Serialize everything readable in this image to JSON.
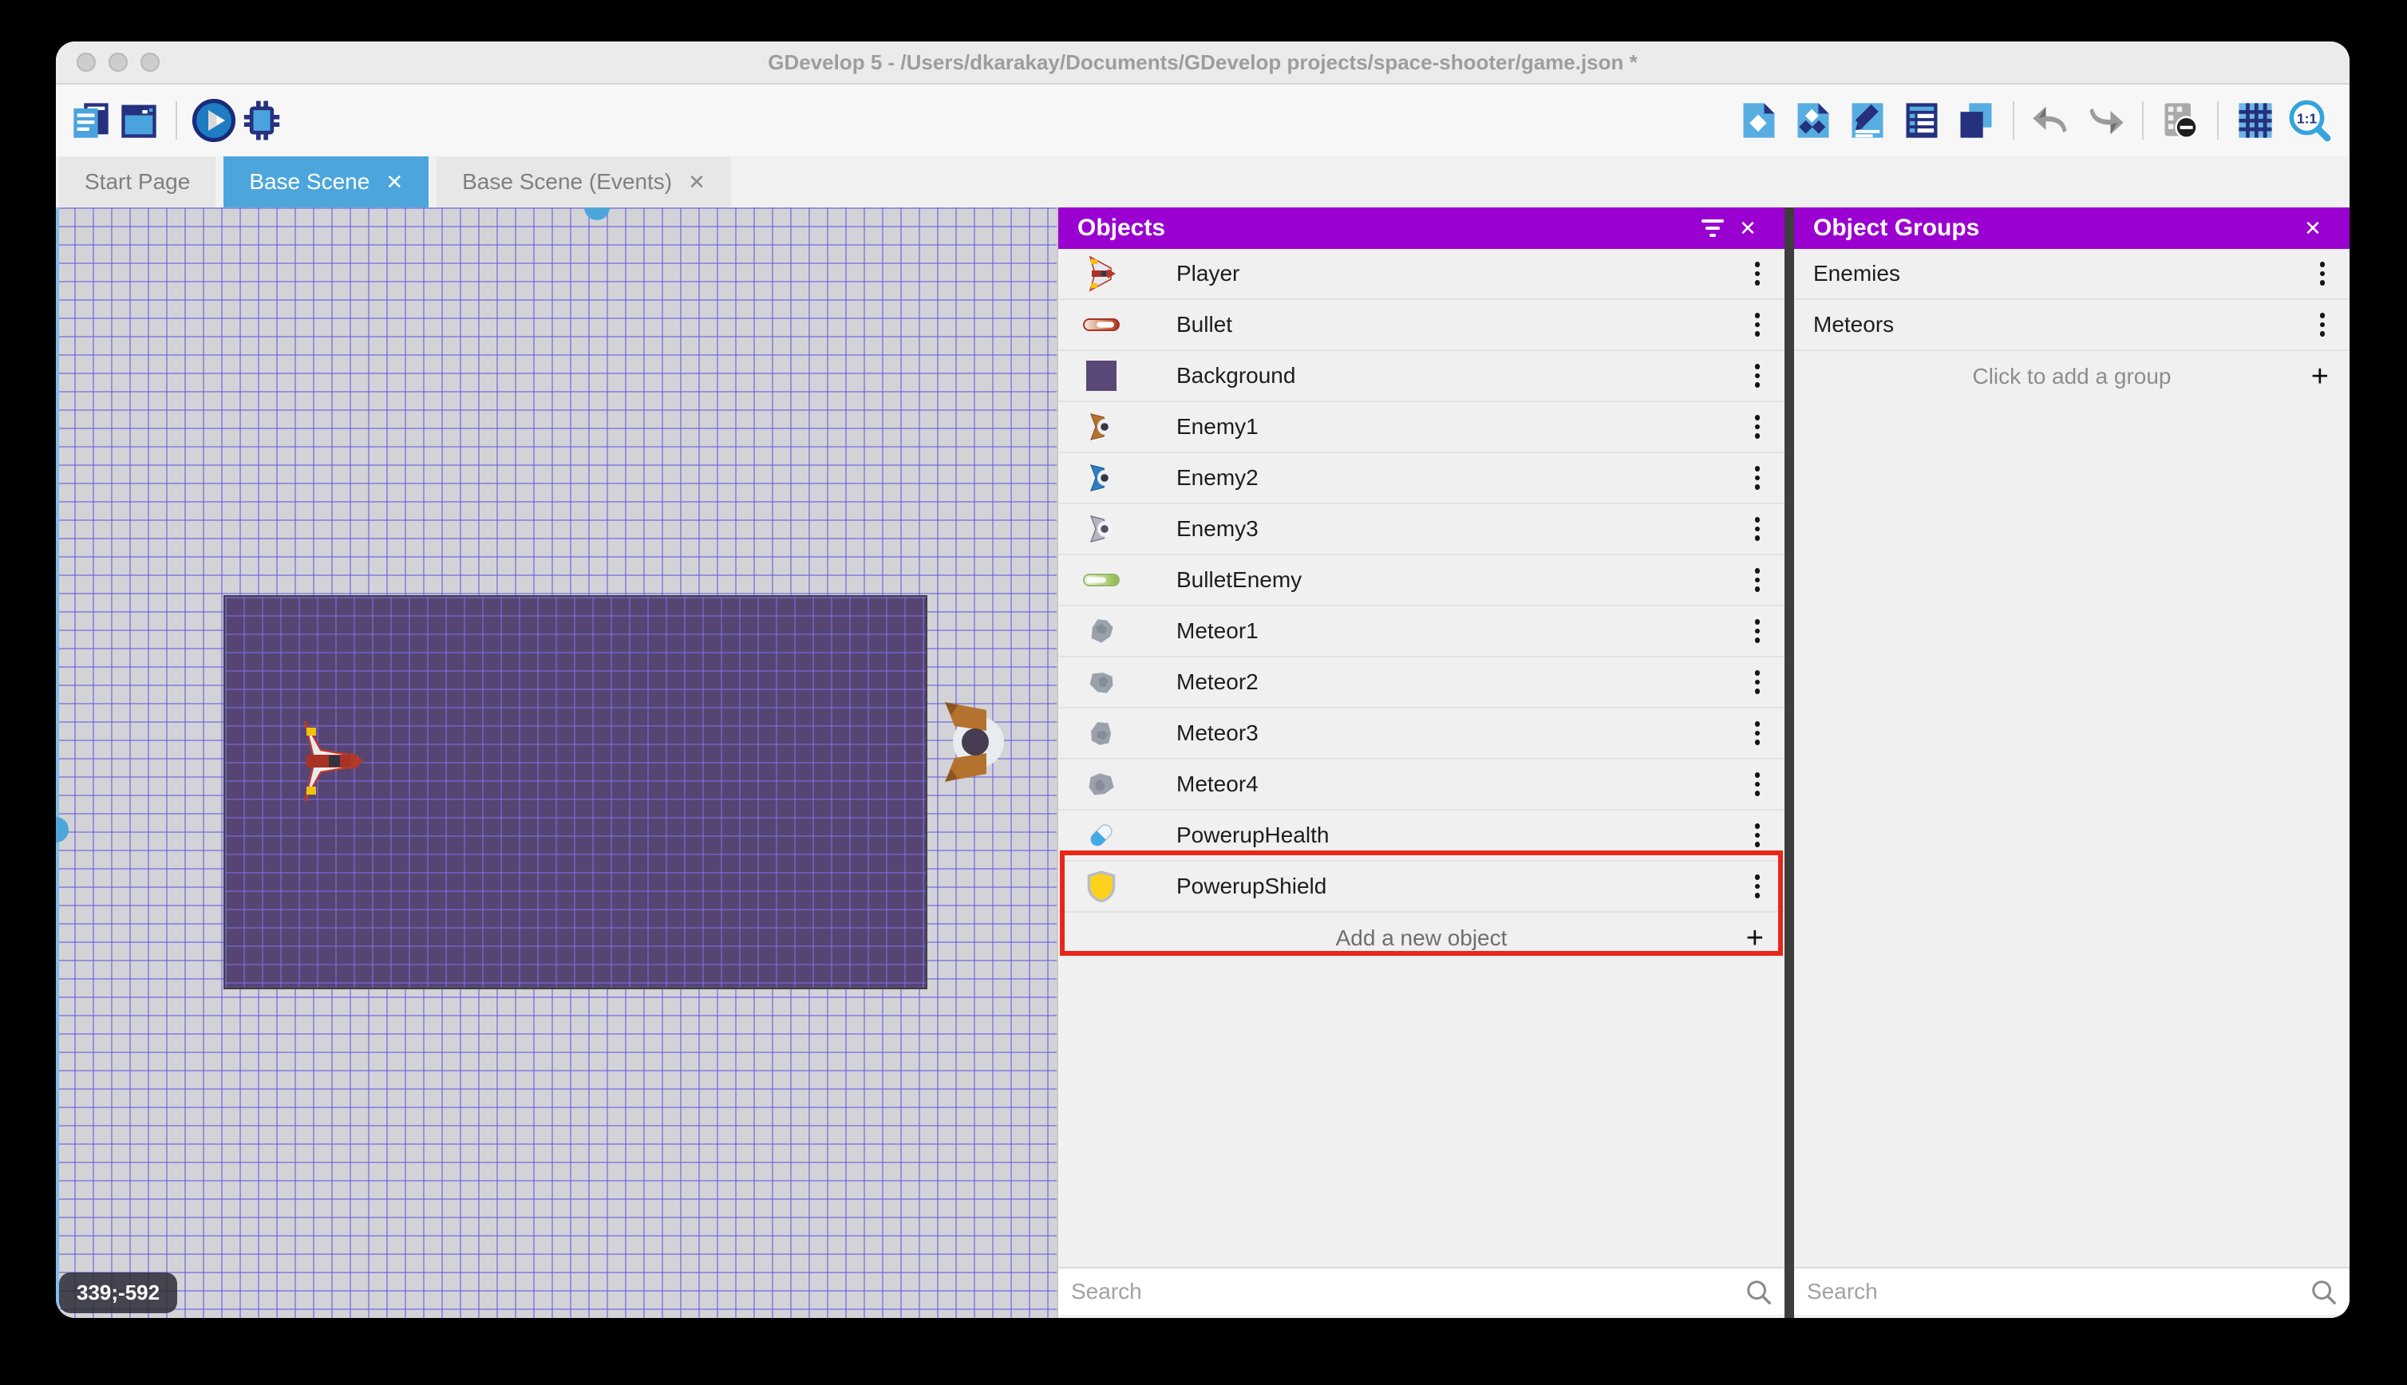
{
  "window": {
    "title": "GDevelop 5 - /Users/dkarakay/Documents/GDevelop projects/space-shooter/game.json *"
  },
  "glyphs": {
    "close": "✕",
    "plus": "+"
  },
  "toolbar": {
    "zoom_label": "1:1",
    "icons_left": [
      "project-manager",
      "start-page-window",
      "play",
      "debug"
    ],
    "icons_right": [
      "add-object",
      "object-groups",
      "edit-scene-properties",
      "instances-list",
      "layers",
      "undo",
      "redo",
      "render-options",
      "grid",
      "zoom-1-1"
    ]
  },
  "tabs": [
    {
      "label": "Start Page",
      "active": false,
      "closable": false
    },
    {
      "label": "Base Scene",
      "active": true,
      "closable": true
    },
    {
      "label": "Base Scene (Events)",
      "active": false,
      "closable": true
    }
  ],
  "canvas": {
    "coordinates": "339;-592"
  },
  "objects_panel": {
    "title": "Objects",
    "items": [
      {
        "name": "Player",
        "icon": "player-ship"
      },
      {
        "name": "Bullet",
        "icon": "bullet-red"
      },
      {
        "name": "Background",
        "icon": "background-tile"
      },
      {
        "name": "Enemy1",
        "icon": "enemy-ship-brown"
      },
      {
        "name": "Enemy2",
        "icon": "enemy-ship-blue"
      },
      {
        "name": "Enemy3",
        "icon": "enemy-ship-gray"
      },
      {
        "name": "BulletEnemy",
        "icon": "bullet-green"
      },
      {
        "name": "Meteor1",
        "icon": "meteor"
      },
      {
        "name": "Meteor2",
        "icon": "meteor"
      },
      {
        "name": "Meteor3",
        "icon": "meteor"
      },
      {
        "name": "Meteor4",
        "icon": "meteor"
      },
      {
        "name": "PowerupHealth",
        "icon": "health-pill"
      },
      {
        "name": "PowerupShield",
        "icon": "shield"
      }
    ],
    "add_label": "Add a new object",
    "search_placeholder": "Search"
  },
  "groups_panel": {
    "title": "Object Groups",
    "items": [
      {
        "name": "Enemies"
      },
      {
        "name": "Meteors"
      }
    ],
    "add_label": "Click to add a group",
    "search_placeholder": "Search"
  },
  "colors": {
    "accent_purple": "#9a00d0",
    "accent_blue": "#4da6db",
    "highlight_red": "#ea2517"
  }
}
